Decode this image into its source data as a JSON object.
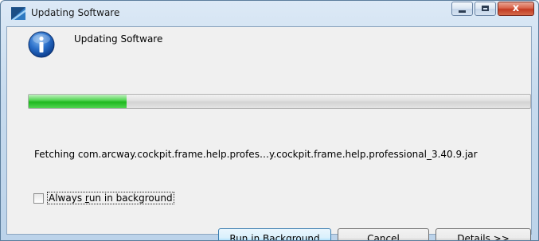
{
  "window": {
    "title": "Updating Software",
    "icon": "eclipse-app-icon",
    "controls": {
      "minimize_icon": "minimize-icon",
      "maximize_icon": "maximize-icon",
      "close_label": "x",
      "close_icon": "close-icon"
    }
  },
  "dialog": {
    "icon": "info-icon",
    "heading": "Updating Software",
    "progress_fraction": 0.196,
    "status": "Fetching com.arcway.cockpit.frame.help.profes…y.cockpit.frame.help.professional_3.40.9.jar",
    "checkbox": {
      "label_before": "Always ",
      "label_mnemonic": "r",
      "label_after": "un in background",
      "checked": false
    },
    "buttons": {
      "run_in_background": "Run in Background",
      "cancel": "Cancel",
      "details_mnemonic": "D",
      "details_rest": "etails >>"
    }
  },
  "colors": {
    "progress_green": "#1eb81e",
    "close_red": "#c23b22",
    "default_button_border": "#3c7fb1"
  }
}
